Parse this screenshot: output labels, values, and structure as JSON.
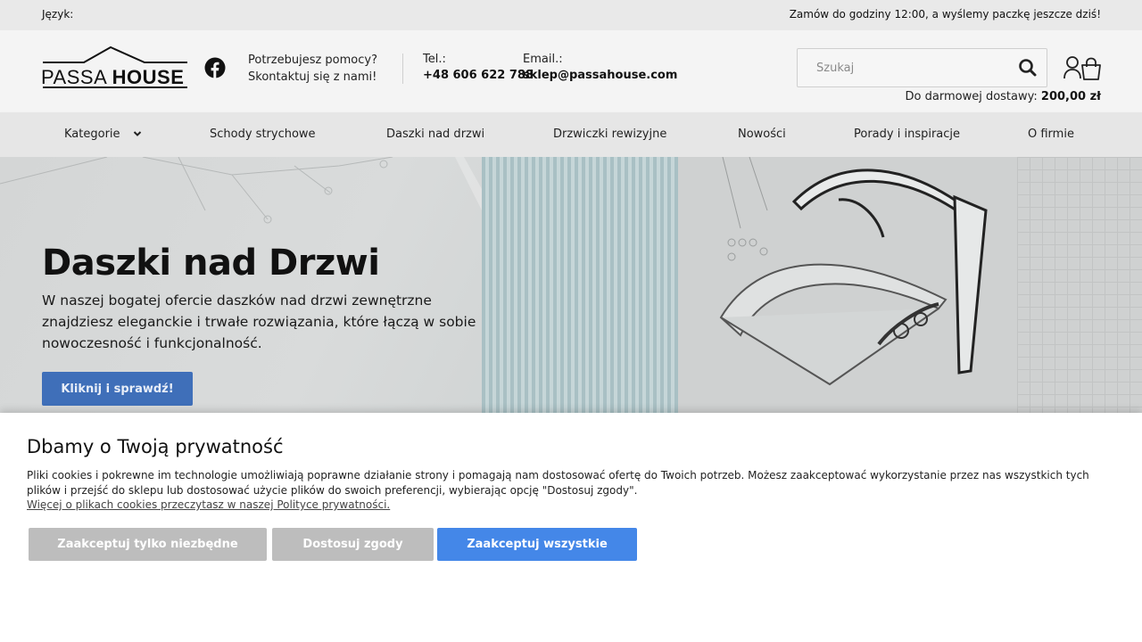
{
  "topbar": {
    "language_label": "Język:",
    "promo": "Zamów do godziny 12:00, a wyślemy paczkę jeszcze dziś!"
  },
  "header": {
    "logo_text_left": "PASSA",
    "logo_text_right": "HOUSE",
    "help_line1": "Potrzebujesz pomocy?",
    "help_line2": "Skontaktuj się z nami!",
    "phone_label": "Tel.:",
    "phone_value": "+48 606 622 788",
    "email_label": "Email.:",
    "email_value": "sklep@passahouse.com",
    "search_placeholder": "Szukaj",
    "free_shipping_label": "Do darmowej dostawy:",
    "free_shipping_value": "200,00 zł"
  },
  "nav": {
    "items": [
      {
        "label": "Kategorie"
      },
      {
        "label": "Schody strychowe"
      },
      {
        "label": "Daszki nad drzwi"
      },
      {
        "label": "Drzwiczki rewizyjne"
      },
      {
        "label": "Nowości"
      },
      {
        "label": "Porady i inspiracje"
      },
      {
        "label": "O firmie"
      }
    ]
  },
  "hero": {
    "title": "Daszki nad Drzwi",
    "description": "W naszej bogatej ofercie daszków nad drzwi zewnętrzne znajdziesz eleganckie i trwałe rozwiązania, które łączą w sobie nowoczesność i funkcjonalność.",
    "cta_label": "Kliknij i sprawdź!"
  },
  "cookie": {
    "title": "Dbamy o Twoją prywatność",
    "description": "Pliki cookies i pokrewne im technologie umożliwiają poprawne działanie strony i pomagają nam dostosować ofertę do Twoich potrzeb. Możesz zaakceptować wykorzystanie przez nas wszystkich tych plików i przejść do sklepu lub dostosować użycie plików do swoich preferencji, wybierając opcję \"Dostosuj zgody\".",
    "policy_link": "Więcej o plikach cookies przeczytasz w naszej Polityce prywatności.",
    "btn_necessary": "Zaakceptuj tylko niezbędne",
    "btn_customize": "Dostosuj zgody",
    "btn_accept_all": "Zaakceptuj wszystkie"
  },
  "colors": {
    "cta_blue": "#3f6fb9",
    "accept_blue": "#4487e8",
    "secondary_gray": "#bdbdbd"
  }
}
